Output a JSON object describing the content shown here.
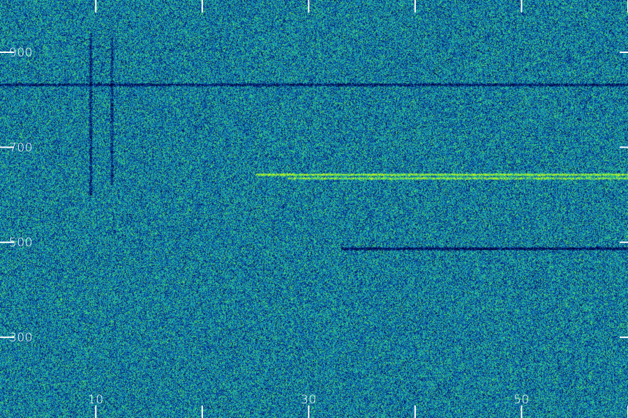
{
  "chart_data": {
    "type": "heatmap",
    "title": "",
    "xlabel": "",
    "ylabel": "",
    "x_ticks": [
      10,
      30,
      50
    ],
    "y_ticks": [
      900,
      700,
      500,
      300
    ],
    "xlim": [
      1,
      60
    ],
    "ylim": [
      130,
      1010
    ],
    "colormap": [
      "#020a40",
      "#06318f",
      "#0f6fb4",
      "#1ca8b0",
      "#39d56a",
      "#b7f020"
    ],
    "background_noise": 0.45,
    "features": [
      {
        "kind": "horizontal_line",
        "name": "",
        "y": 643,
        "x_start": 25,
        "x_end": 60,
        "intensity": 1.0
      },
      {
        "kind": "horizontal_line",
        "name": "",
        "y": 635,
        "x_start": 28,
        "x_end": 60,
        "intensity": 0.8
      },
      {
        "kind": "horizontal_dark_band",
        "name": "",
        "y": 832,
        "x_start": 1,
        "x_end": 60,
        "intensity": -0.5
      },
      {
        "kind": "horizontal_dark_band",
        "name": "",
        "y": 487,
        "x_start": 33,
        "x_end": 60,
        "intensity": -0.6
      },
      {
        "kind": "vertical_dark_band",
        "name": "",
        "x": 9.5,
        "y_start": 600,
        "y_end": 940,
        "intensity": -0.4
      },
      {
        "kind": "vertical_dark_band",
        "name": "",
        "x": 11.5,
        "y_start": 620,
        "y_end": 930,
        "intensity": -0.35
      }
    ]
  }
}
